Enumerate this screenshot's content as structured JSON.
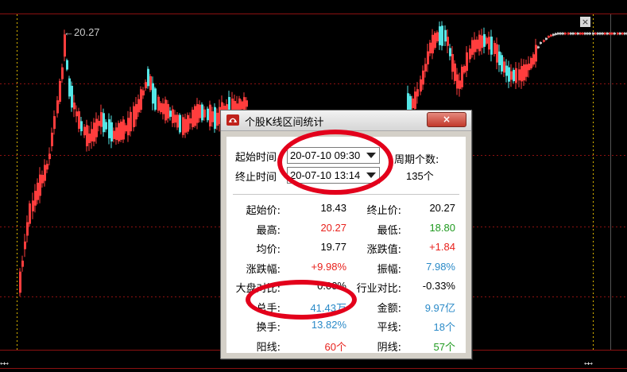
{
  "chart": {
    "peak_label": "←20.27",
    "close_label": "×",
    "left_scroll": "↤↦",
    "right_scroll": "↤↦",
    "colors": {
      "up": "#ff3d3d",
      "down": "#54e6e6",
      "flat": "#d0d0d0",
      "grid": "#8b1111",
      "dotted_vline": "#d8b400"
    }
  },
  "dialog": {
    "title": "个股K线区间统计",
    "close_label": "×",
    "start_label": "起始时间",
    "end_label": "终止时间",
    "start_value": "20-07-10 09:30",
    "end_value": "20-07-10 13:14",
    "period_label": "周期个数:",
    "period_value": "135个",
    "left_stats": [
      {
        "label": "起始价:",
        "value": "18.43",
        "color": "black"
      },
      {
        "label": "最高:",
        "value": "20.27",
        "color": "red"
      },
      {
        "label": "均价:",
        "value": "19.77",
        "color": "black"
      },
      {
        "label": "涨跌幅:",
        "value": "+9.98%",
        "color": "red"
      },
      {
        "label": "大盘对比:",
        "value": "0.00%",
        "color": "black"
      },
      {
        "label": "总手:",
        "value": "41.43万",
        "color": "blue"
      },
      {
        "label": "换手:",
        "value": "13.82%",
        "color": "blue"
      },
      {
        "label": "阳线:",
        "value": "60个",
        "color": "red"
      }
    ],
    "right_stats": [
      {
        "label": "终止价:",
        "value": "20.27",
        "color": "black"
      },
      {
        "label": "最低:",
        "value": "18.80",
        "color": "green"
      },
      {
        "label": "涨跌值:",
        "value": "+1.84",
        "color": "red"
      },
      {
        "label": "振幅:",
        "value": "7.98%",
        "color": "blue"
      },
      {
        "label": "行业对比:",
        "value": "-0.33%",
        "color": "black"
      },
      {
        "label": "金额:",
        "value": "9.97亿",
        "color": "blue"
      },
      {
        "label": "平线:",
        "value": "18个",
        "color": "blue"
      },
      {
        "label": "阴线:",
        "value": "57个",
        "color": "green"
      }
    ]
  }
}
